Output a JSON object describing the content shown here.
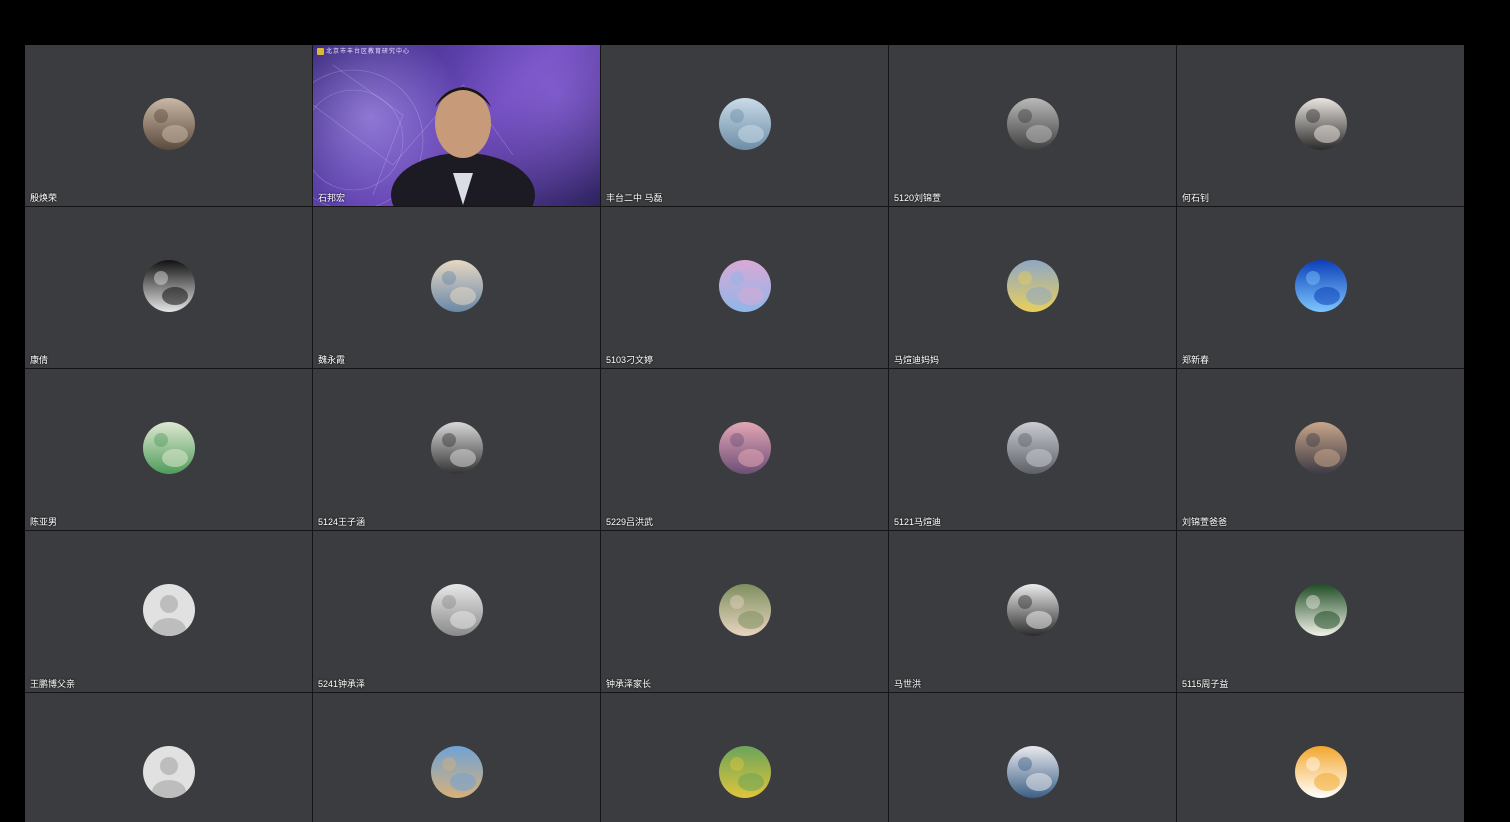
{
  "meeting": {
    "participants": [
      {
        "name": "殷焕荣",
        "avatar": "avatar-group-photo",
        "colors": [
          "#c9b8a6",
          "#5b4a3c"
        ]
      },
      {
        "name": "石邦宏",
        "video": true,
        "banner": "北京市丰台区教育研究中心"
      },
      {
        "name": "丰台二中 马磊",
        "avatar": "avatar-beach-silhouettes",
        "colors": [
          "#c9dbe8",
          "#6d8da6"
        ]
      },
      {
        "name": "5120刘锦萱",
        "avatar": "avatar-old-man-photo",
        "colors": [
          "#b9b9b9",
          "#3f3f3f"
        ]
      },
      {
        "name": "何石钊",
        "avatar": "avatar-cartoon-face",
        "colors": [
          "#e9e4df",
          "#2a2a2a"
        ]
      },
      {
        "name": "康倩",
        "avatar": "avatar-sketch-portrait",
        "colors": [
          "#111111",
          "#e6e6e6"
        ]
      },
      {
        "name": "魏永霞",
        "avatar": "avatar-sunhat-photo",
        "colors": [
          "#e6d8c2",
          "#6a88a8"
        ]
      },
      {
        "name": "5103刁文婷",
        "avatar": "avatar-pastel-sky",
        "colors": [
          "#d9a9d6",
          "#8fb6e8"
        ]
      },
      {
        "name": "马煊迪妈妈",
        "avatar": "avatar-yellow-flowers",
        "colors": [
          "#8ea7c6",
          "#e8cf5a"
        ]
      },
      {
        "name": "郑新春",
        "avatar": "avatar-blue-horizon",
        "colors": [
          "#0d3fb8",
          "#7ec7ff"
        ]
      },
      {
        "name": "陈亚男",
        "avatar": "avatar-anime-girl",
        "colors": [
          "#dfe8d2",
          "#4e9c5a"
        ]
      },
      {
        "name": "5124王子涵",
        "avatar": "avatar-city-skyline",
        "colors": [
          "#d7d7d7",
          "#333333"
        ]
      },
      {
        "name": "5229吕洪武",
        "avatar": "avatar-pink-sunset",
        "colors": [
          "#e3a6b5",
          "#6c4f77"
        ]
      },
      {
        "name": "5121马煊迪",
        "avatar": "avatar-winter-tree",
        "colors": [
          "#c9ccd2",
          "#5d6066"
        ]
      },
      {
        "name": "刘锦萱爸爸",
        "avatar": "avatar-dusk-silhouette",
        "colors": [
          "#c8a58a",
          "#3c3a44"
        ]
      },
      {
        "name": "王鹏博父亲",
        "avatar": "avatar-default-person",
        "colors": [
          "#e1e1e1",
          "#bdbdbd"
        ]
      },
      {
        "name": "5241钟承泽",
        "avatar": "avatar-sketch-face",
        "colors": [
          "#e8e8e8",
          "#8a8a8a"
        ]
      },
      {
        "name": "钟承泽家长",
        "avatar": "avatar-girl-portrait",
        "colors": [
          "#7d8f5e",
          "#e9d4c1"
        ]
      },
      {
        "name": "马世洪",
        "avatar": "avatar-galloping-horse",
        "colors": [
          "#ececec",
          "#2b2b2b"
        ]
      },
      {
        "name": "5115周子益",
        "avatar": "avatar-lotus-flower",
        "colors": [
          "#1f4d26",
          "#f2f2e8"
        ]
      },
      {
        "name": "",
        "avatar": "avatar-default-person",
        "colors": [
          "#e1e1e1",
          "#bdbdbd"
        ]
      },
      {
        "name": "",
        "avatar": "avatar-pier-seascape",
        "colors": [
          "#6fa3d6",
          "#d8b07a"
        ]
      },
      {
        "name": "",
        "avatar": "avatar-parrot-feathers",
        "colors": [
          "#6aa45a",
          "#e0c53c"
        ]
      },
      {
        "name": "",
        "avatar": "avatar-anime-blue-hair",
        "colors": [
          "#e9e9ee",
          "#3b5f86"
        ]
      },
      {
        "name": "",
        "avatar": "avatar-garfield-cat",
        "colors": [
          "#f3a72c",
          "#ffffff"
        ]
      }
    ]
  }
}
